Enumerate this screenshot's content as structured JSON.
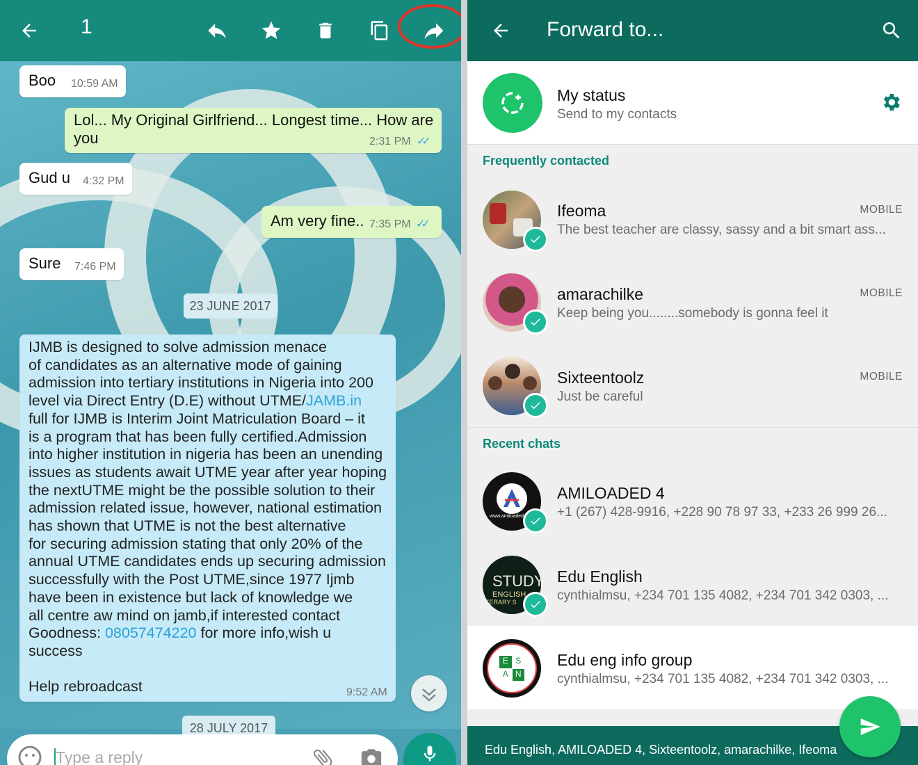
{
  "left_panel": {
    "selected_count": "1",
    "messages": [
      {
        "text": "Boo",
        "time": "10:59 AM",
        "dir": "in"
      },
      {
        "text": "Lol... My Original Girlfriend... Longest time... How are you",
        "time": "2:31 PM",
        "dir": "out"
      },
      {
        "text": "Gud u",
        "time": "4:32 PM",
        "dir": "in"
      },
      {
        "text": "Am very fine..",
        "time": "7:35 PM",
        "dir": "out"
      },
      {
        "text": "Sure",
        "time": "7:46 PM",
        "dir": "in"
      }
    ],
    "date_chip_1": "23 JUNE 2017",
    "long_message": {
      "part1": "IJMB is designed to solve admission menace\nof candidates as an alternative mode of gaining\nadmission into tertiary institutions in Nigeria into 200\nlevel via Direct Entry (D.E) without UTME/",
      "link1": "JAMB.in",
      "part2": "\nfull for IJMB is Interim Joint Matriculation Board – it\nis a program that has been fully certified.Admission\ninto higher institution in nigeria has been an unending\nissues as students await UTME year after year hoping\nthe nextUTME might be the possible solution to their\nadmission related issue, however, national estimation\nhas shown that UTME is not the best alternative\nfor securing admission stating that only 20% of the\nannual UTME candidates ends up securing admission\nsuccessfully with the Post UTME,since 1977 Ijmb\nhave been in existence but lack of knowledge we\nall centre aw mind on jamb,if interested contact\nGoodness: ",
      "link2": "08057474220",
      "part3": " for more info,wish u\nsuccess\n\nHelp rebroadcast",
      "time": "9:52 AM"
    },
    "date_chip_2": "28 JULY 2017",
    "composer_placeholder": "Type a reply"
  },
  "right_panel": {
    "title": "Forward to...",
    "my_status": {
      "name": "My status",
      "sub": "Send to my contacts"
    },
    "section_frequent": "Frequently contacted",
    "section_recent": "Recent chats",
    "frequent": [
      {
        "name": "Ifeoma",
        "sub": "The best teacher are classy, sassy and a bit smart ass...",
        "tag": "MOBILE"
      },
      {
        "name": "amarachilke",
        "sub": "Keep being you........somebody is gonna feel it",
        "tag": "MOBILE"
      },
      {
        "name": "Sixteentoolz",
        "sub": "Just be careful",
        "tag": "MOBILE"
      }
    ],
    "recent": [
      {
        "name": "AMILOADED 4",
        "sub": "+1 (267) 428-9916, +228 90 78 97 33, +233 26 999 26..."
      },
      {
        "name": "Edu English",
        "sub": "cynthialmsu, +234 701 135 4082, +234 701 342 0303, ..."
      },
      {
        "name": "Edu eng info group",
        "sub": "cynthialmsu, +234 701 135 4082, +234 701 342 0303, ..."
      }
    ],
    "selected_summary": "Edu English, AMILOADED 4, Sixteentoolz, amarachilke, Ifeoma",
    "avatar_text": {
      "amiloaded": "www.amiloaded",
      "study": "STUDY",
      "english": "ENGLISH",
      "literary": "TERARY S",
      "esan": [
        "E",
        "S",
        "A",
        "N"
      ]
    }
  },
  "colors": {
    "header_left": "#168a7c",
    "header_right": "#0d6b5e",
    "accent": "#0b8a78",
    "fab": "#1ec36b",
    "check": "#1eb99a"
  }
}
